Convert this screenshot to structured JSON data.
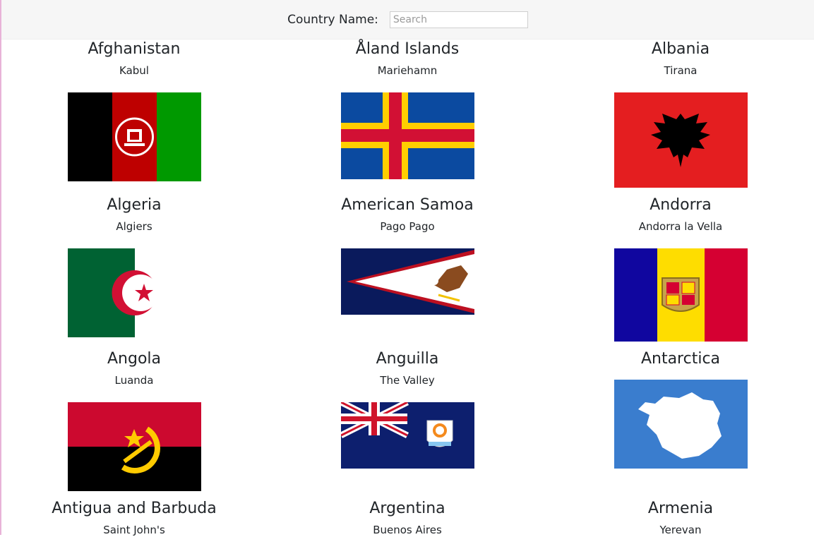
{
  "search": {
    "label": "Country Name:",
    "placeholder": "Search",
    "value": ""
  },
  "countries": [
    {
      "name": "Afghanistan",
      "capital": "Kabul",
      "flag_icon": "afghanistan-flag"
    },
    {
      "name": "Åland Islands",
      "capital": "Mariehamn",
      "flag_icon": "aland-islands-flag"
    },
    {
      "name": "Albania",
      "capital": "Tirana",
      "flag_icon": "albania-flag"
    },
    {
      "name": "Algeria",
      "capital": "Algiers",
      "flag_icon": "algeria-flag"
    },
    {
      "name": "American Samoa",
      "capital": "Pago Pago",
      "flag_icon": "american-samoa-flag"
    },
    {
      "name": "Andorra",
      "capital": "Andorra la Vella",
      "flag_icon": "andorra-flag"
    },
    {
      "name": "Angola",
      "capital": "Luanda",
      "flag_icon": "angola-flag"
    },
    {
      "name": "Anguilla",
      "capital": "The Valley",
      "flag_icon": "anguilla-flag"
    },
    {
      "name": "Antarctica",
      "capital": "",
      "flag_icon": "antarctica-flag"
    },
    {
      "name": "Antigua and Barbuda",
      "capital": "Saint John's",
      "flag_icon": "antigua-and-barbuda-flag"
    },
    {
      "name": "Argentina",
      "capital": "Buenos Aires",
      "flag_icon": "argentina-flag"
    },
    {
      "name": "Armenia",
      "capital": "Yerevan",
      "flag_icon": "armenia-flag"
    }
  ]
}
